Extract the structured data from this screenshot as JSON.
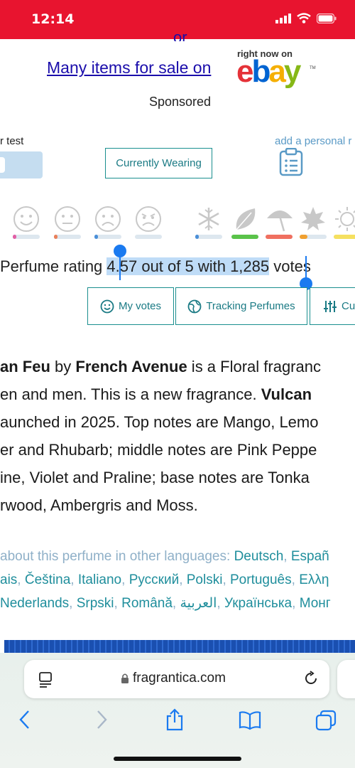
{
  "status": {
    "time": "12:14",
    "icons": [
      "signal-icon",
      "wifi-icon",
      "battery-icon"
    ]
  },
  "ad": {
    "top_link": "or",
    "text": "Many items for sale on",
    "right_now": "right now on",
    "brand": {
      "e": "e",
      "b": "b",
      "a": "a",
      "y": "y"
    },
    "tm": "TM",
    "sponsored": "Sponsored"
  },
  "controls": {
    "test_label": "r test",
    "currently_wearing": "Currently Wearing",
    "personal_label": "add a personal r"
  },
  "ratings": {
    "faces": [
      "love-face-icon",
      "neutral-face-icon",
      "sad-face-icon",
      "angry-face-icon"
    ],
    "face_fill": [
      0.08,
      0.04,
      0.04,
      0.0
    ],
    "face_colors": [
      "#e15fa5",
      "#e9805a",
      "#4a8fd8",
      "#cccccc"
    ],
    "seasons": [
      "winter-icon",
      "spring-icon",
      "summer-icon",
      "autumn-icon",
      "day-icon"
    ],
    "season_fill": [
      0.12,
      1.0,
      1.0,
      0.3,
      0.9
    ],
    "season_colors": [
      "#4a8fd8",
      "#5ac34a",
      "#f07060",
      "#f0a030",
      "#f5e060"
    ]
  },
  "rating_line": {
    "prefix": "Perfume rating ",
    "selected_a": "4.57 out of 5 with 1,285",
    "suffix": " votes"
  },
  "buttons": {
    "my_votes": "My votes",
    "tracking": "Tracking Perfumes",
    "cu": "Cu"
  },
  "description": {
    "l1a": "an Feu",
    "l1b": " by ",
    "l1c": "French Avenue",
    "l1d": " is a Floral fragranc",
    "l2a": "en and men. This is a new fragrance. ",
    "l2b": "Vulcan",
    "l3": "aunched in 2025. Top notes are Mango, Lemo",
    "l4": "er and Rhubarb; middle notes are Pink Peppe",
    "l5": "ine, Violet and Praline; base notes are Tonka",
    "l6": "rwood, Ambergris and Moss."
  },
  "languages": {
    "intro": "about this perfume in other languages: ",
    "row1": [
      "Deutsch",
      "Españ"
    ],
    "row2_lead": "ais",
    "row2": [
      "Čeština",
      "Italiano",
      "Русский",
      "Polski",
      "Português",
      "Ελλη"
    ],
    "row3": [
      "Nederlands",
      "Srpski",
      "Română",
      "العربية",
      "Українська",
      "Монг"
    ]
  },
  "browser": {
    "url": "fragrantica.com"
  }
}
